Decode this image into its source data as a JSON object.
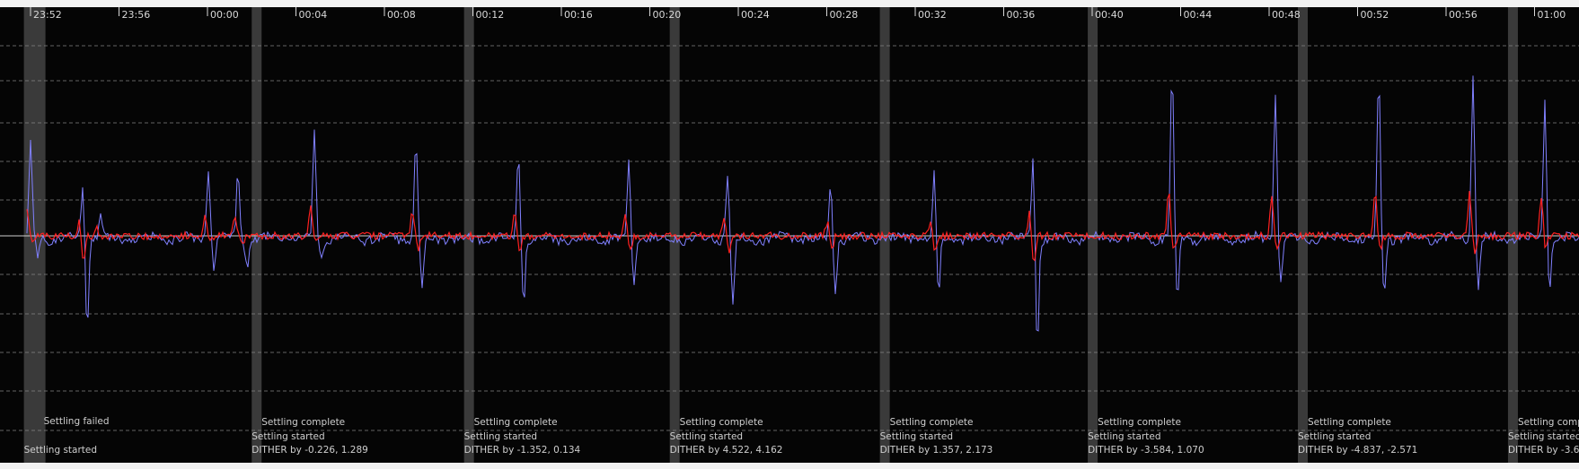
{
  "chart_data": {
    "type": "line",
    "title": "",
    "xlabel": "",
    "ylabel": "",
    "x_ticks": [
      "23:52",
      "23:56",
      "00:00",
      "00:04",
      "00:08",
      "00:12",
      "00:16",
      "00:20",
      "00:24",
      "00:28",
      "00:32",
      "00:36",
      "00:40",
      "00:44",
      "00:48",
      "00:52",
      "00:56",
      "01:00"
    ],
    "grid": true,
    "legend": "none",
    "series": [
      {
        "color": "#8080ff",
        "style": "RA guide error (blue trace)"
      },
      {
        "color": "#ff2020",
        "style": "Dec guide error (red trace)"
      }
    ],
    "colors": {
      "background": "#050505",
      "grid": "#8a8a8a",
      "band": "#3a3a3a",
      "zero": "#d0d0d0",
      "ra": "#8080ff",
      "dec": "#ff2020"
    },
    "dither_events": [
      {
        "time": "23:51.7",
        "lines": [
          "Settling failed",
          "Settling started"
        ]
      },
      {
        "time": "24:02.0",
        "lines": [
          "Settling complete",
          "Settling started",
          "DITHER by -0.226, 1.289"
        ]
      },
      {
        "time": "24:11.6",
        "lines": [
          "Settling complete",
          "Settling started",
          "DITHER by -1.352, 0.134"
        ]
      },
      {
        "time": "24:20.9",
        "lines": [
          "Settling complete",
          "Settling started",
          "DITHER by 4.522, 4.162"
        ]
      },
      {
        "time": "24:30.4",
        "lines": [
          "Settling complete",
          "Settling started",
          "DITHER by 1.357, 2.173"
        ]
      },
      {
        "time": "24:39.8",
        "lines": [
          "Settling complete",
          "Settling started",
          "DITHER by -3.584, 1.070"
        ]
      },
      {
        "time": "24:49.3",
        "lines": [
          "Settling complete",
          "Settling started",
          "DITHER by -4.837, -2.571"
        ]
      },
      {
        "time": "24:58.8",
        "lines": [
          "Settling complete",
          "Settling started",
          "DITHER by -3.6"
        ]
      }
    ]
  }
}
